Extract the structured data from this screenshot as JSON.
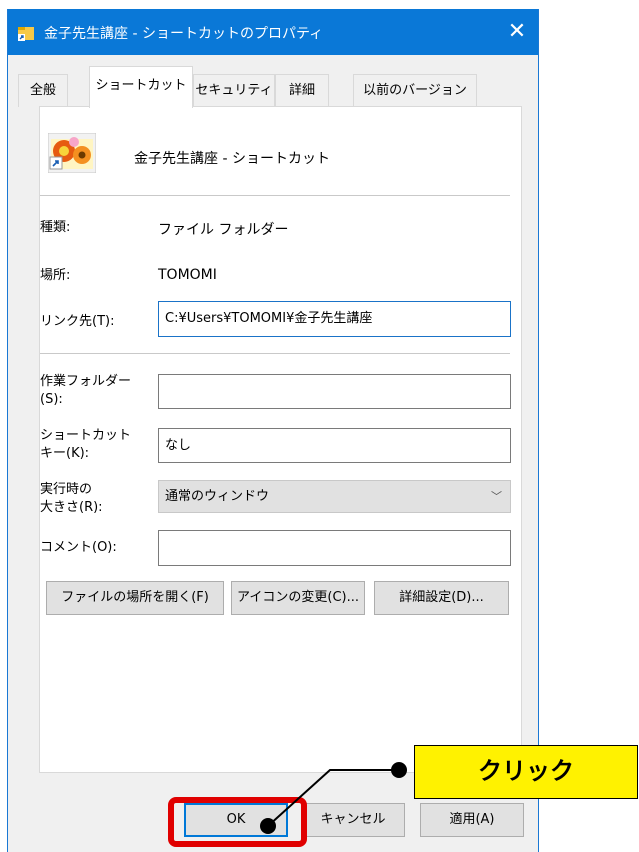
{
  "window": {
    "title": "金子先生講座 - ショートカットのプロパティ",
    "close_label": "✕"
  },
  "tabs": [
    {
      "label": "全般",
      "active": false
    },
    {
      "label": "ショートカット",
      "active": true
    },
    {
      "label": "セキュリティ",
      "active": false
    },
    {
      "label": "詳細",
      "active": false
    },
    {
      "label": "以前のバージョン",
      "active": false
    }
  ],
  "header": {
    "name": "金子先生講座 - ショートカット"
  },
  "info": {
    "type_label": "種類:",
    "type_value": "ファイル フォルダー",
    "location_label": "場所:",
    "location_value": "TOMOMI",
    "target_label": "リンク先(T):",
    "target_value": "C:¥Users¥TOMOMI¥金子先生講座"
  },
  "fields": {
    "start_in_label": "作業フォルダー\n(S):",
    "start_in_value": "",
    "hotkey_label": "ショートカット\nキー(K):",
    "hotkey_value": "なし",
    "run_label": "実行時の\n大きさ(R):",
    "run_value": "通常のウィンドウ",
    "comment_label": "コメント(O):",
    "comment_value": ""
  },
  "buttons": {
    "open_location": "ファイルの場所を開く(F)",
    "change_icon": "アイコンの変更(C)...",
    "advanced": "詳細設定(D)...",
    "ok": "OK",
    "cancel": "キャンセル",
    "apply": "適用(A)"
  },
  "annotation": {
    "callout_text": "クリック"
  },
  "colors": {
    "titlebar": "#0a78d7",
    "highlight": "#e00000",
    "callout_bg": "#fff200"
  }
}
